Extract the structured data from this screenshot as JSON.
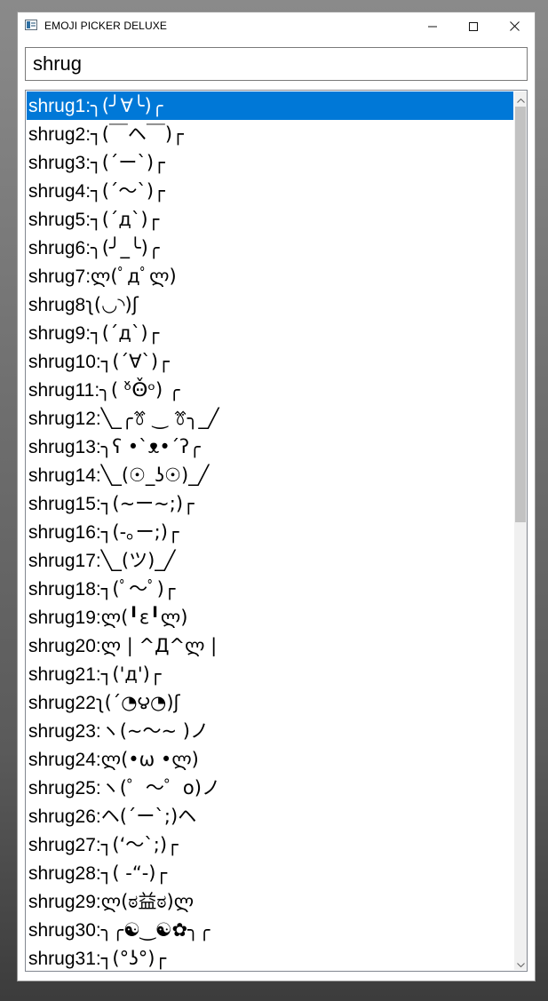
{
  "window": {
    "title": "EMOJI PICKER DELUXE",
    "icons": {
      "app": "app-window-icon",
      "minimize": "minimize-icon",
      "maximize": "maximize-icon",
      "close": "close-icon"
    }
  },
  "search": {
    "value": "shrug"
  },
  "results": {
    "selected_index": 0,
    "items": [
      {
        "name": "shrug1:",
        "emoji": "╮(╯∀╰)╭"
      },
      {
        "name": "shrug2:",
        "emoji": "┐(￣ヘ￣)┌"
      },
      {
        "name": "shrug3:",
        "emoji": "┐(´ー`)┌"
      },
      {
        "name": "shrug4:",
        "emoji": "┐(´～`)┌"
      },
      {
        "name": "shrug5:",
        "emoji": "┐(´д`)┌"
      },
      {
        "name": "shrug6:",
        "emoji": "╮(╯_╰)╭"
      },
      {
        "name": "shrug7:",
        "emoji": "ლ(ﾟдﾟლ)"
      },
      {
        "name": "shrug8",
        "emoji": "ʅ(◡◝)ʃ"
      },
      {
        "name": "shrug9:",
        "emoji": "┐(´д`)┌"
      },
      {
        "name": "shrug10:",
        "emoji": "┐(´∀`)┌"
      },
      {
        "name": "shrug11:",
        "emoji": "╮( ᵒ̌Ꙫ̌ᵒ) ╭"
      },
      {
        "name": "shrug12:",
        "emoji": "╲_╭ꔢ ‿ ꔢ╮_╱"
      },
      {
        "name": "shrug13:",
        "emoji": "╮ʕ •`ᴥ•´ʔ╭"
      },
      {
        "name": "shrug14:",
        "emoji": "╲_(☉_ʖ☉)_╱"
      },
      {
        "name": "shrug15:",
        "emoji": "┐(~ー~;)┌"
      },
      {
        "name": "shrug16:",
        "emoji": "┐(-｡ー;)┌"
      },
      {
        "name": "shrug17:",
        "emoji": "╲_(ツ)_╱"
      },
      {
        "name": "shrug18:",
        "emoji": "┐(ﾟ～ﾟ)┌"
      },
      {
        "name": "shrug19:",
        "emoji": "ლ(╹ε╹ლ)"
      },
      {
        "name": "shrug20:",
        "emoji": "ლ | ^Д^ლ |"
      },
      {
        "name": "shrug21:",
        "emoji": "┐('д')┌"
      },
      {
        "name": "shrug22",
        "emoji": "ʅ(´◔౪◔)ʃ"
      },
      {
        "name": "shrug23:",
        "emoji": "ヽ(~～~ )ノ"
      },
      {
        "name": "shrug24:",
        "emoji": "ლ(•ω •ლ)"
      },
      {
        "name": "shrug25:",
        "emoji": "ヽ(゜～゜o)ノ"
      },
      {
        "name": "shrug26:",
        "emoji": "ヘ(´ー`;)ヘ"
      },
      {
        "name": "shrug27:",
        "emoji": "┐(‘～`;)┌"
      },
      {
        "name": "shrug28:",
        "emoji": "┐( -“-)┌"
      },
      {
        "name": "shrug29:",
        "emoji": "ლ(ಠ益ಠ)ლ"
      },
      {
        "name": "shrug30:",
        "emoji": "╮╭☯‿☯✿╮╭"
      },
      {
        "name": "shrug31:",
        "emoji": "┐(°ʖ°)┌"
      }
    ]
  },
  "scrollbar": {
    "up_icon": "scroll-up-arrow-icon",
    "down_icon": "scroll-down-arrow-icon",
    "position_fraction": 0.0,
    "visible_fraction": 0.49
  }
}
